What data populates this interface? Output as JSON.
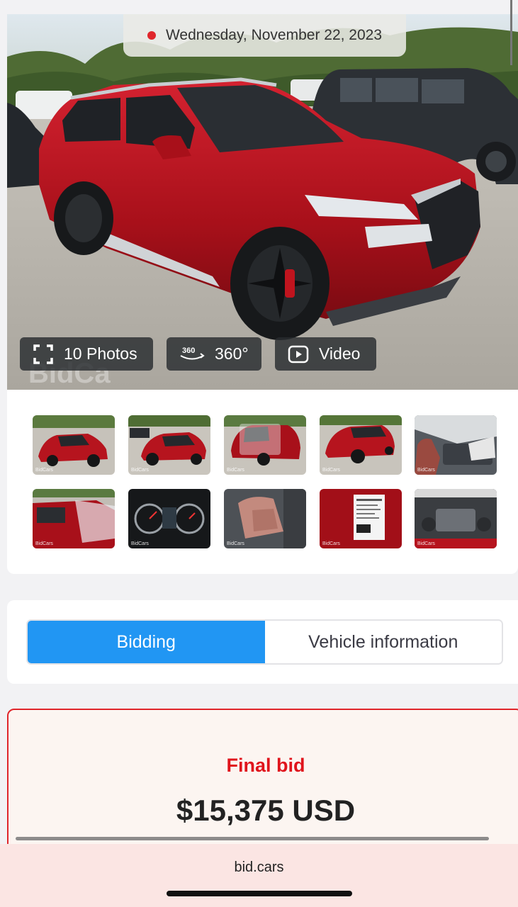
{
  "hero": {
    "date": "Wednesday, November 22, 2023",
    "photos_label": "10 Photos",
    "view360_label": "360°",
    "video_label": "Video",
    "badge_360": "360"
  },
  "thumbnails": {
    "watermark": "BidCars",
    "items": [
      {
        "desc": "front-left exterior"
      },
      {
        "desc": "front exterior"
      },
      {
        "desc": "rear-right exterior"
      },
      {
        "desc": "rear-left exterior"
      },
      {
        "desc": "front interior"
      },
      {
        "desc": "side exterior wrapped"
      },
      {
        "desc": "instrument cluster"
      },
      {
        "desc": "rear seats"
      },
      {
        "desc": "door label"
      },
      {
        "desc": "engine bay"
      }
    ]
  },
  "tabs": {
    "bidding": "Bidding",
    "vehicle_info": "Vehicle information",
    "active": "bidding"
  },
  "bid": {
    "label": "Final bid",
    "value": "$15,375 USD"
  },
  "browser": {
    "url": "bid.cars"
  },
  "colors": {
    "accent_blue": "#2196f3",
    "bid_red": "#e0141c",
    "car_red": "#b0121c"
  }
}
